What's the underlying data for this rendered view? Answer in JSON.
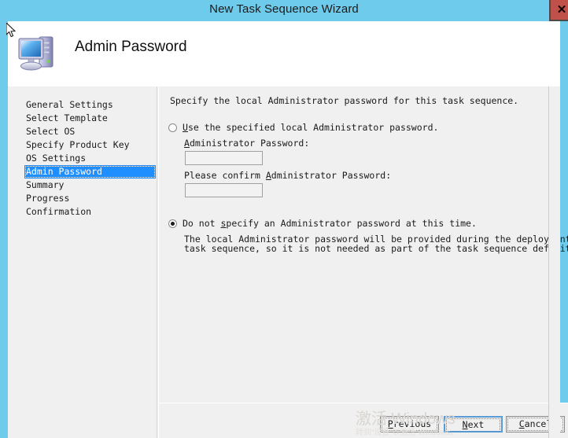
{
  "window": {
    "title": "New Task Sequence Wizard",
    "close_label": "✕",
    "frame_color": "#6ecbeb",
    "titlebar_color": "#6ecbeb",
    "close_color": "#c0504a"
  },
  "header": {
    "page_title": "Admin Password",
    "icon": "computer-icon"
  },
  "sidebar": {
    "selected_index": 5,
    "highlight_color": "#1f8fff",
    "items": [
      {
        "label": "General Settings"
      },
      {
        "label": "Select Template"
      },
      {
        "label": "Select OS"
      },
      {
        "label": "Specify Product Key"
      },
      {
        "label": "OS Settings"
      },
      {
        "label": "Admin Password"
      },
      {
        "label": "Summary"
      },
      {
        "label": "Progress"
      },
      {
        "label": "Confirmation"
      }
    ]
  },
  "content": {
    "intro": "Specify the local Administrator password for this task sequence.",
    "option_specified": {
      "label": "Use the specified local Administrator password.",
      "mnemonic": "U",
      "checked": false,
      "password_label": "Administrator Password:",
      "password_mnemonic": "A",
      "password_value": "",
      "confirm_label": "Please confirm Administrator Password:",
      "confirm_mnemonic": "A",
      "confirm_value": ""
    },
    "option_not_specified": {
      "label": "Do not specify an Administrator password at this time.",
      "mnemonic": "s",
      "checked": true,
      "description_line1": "The local Administrator password will be provided during the deployment of this",
      "description_line2": "task sequence, so it is not needed as part of the task sequence definition."
    }
  },
  "footer": {
    "previous_label": "Previous",
    "previous_mnemonic": "P",
    "next_label": "Next",
    "next_mnemonic": "N",
    "cancel_label": "Cancel",
    "cancel_mnemonic": "C",
    "default_button": "next"
  },
  "watermark": {
    "line1": "激活 Windows",
    "line2": "转到“设置”以激活 Windows。"
  }
}
